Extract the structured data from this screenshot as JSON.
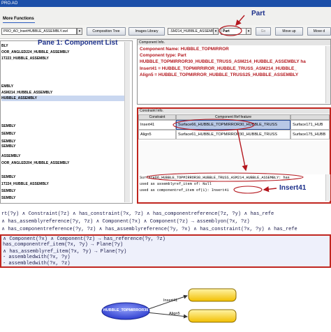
{
  "app": {
    "title": "PRO.AO",
    "menu_more": "More Functions"
  },
  "toolbar": {
    "file_field": "PRO_AO_InsetHUBBLE_ASSEMBLY.swl",
    "composition_tree": "Composition Tree",
    "images_library": "Images Library",
    "assembly_field": ".SM214_HUBBLE_ASSEMBL",
    "type_select": "Part",
    "go": "Go",
    "move_up": "Move up",
    "move_down": "Move d"
  },
  "annotations": {
    "part_callout": "Part",
    "pane1_label": "Pane 1: Component List",
    "insert41_callout": "Insert41"
  },
  "component_list": [
    "BLY",
    "OOR_ANGLED224_HUBBLE_ASSEMBLY",
    "1T223_HUBBLE_ASSEMBLY",
    "EMBLY",
    "ASM214_HUBBLE_ASSEMBLY",
    "HUBBLE_ASSEMBLY",
    "SEMBLY",
    "SEMBLY",
    "SEMBLY",
    "SEMBLY",
    "ASSEMBLY",
    "OOR_ANGLED204_HUBBLE_ASSEMBLY",
    "SEMBLY",
    "1T224_HUBBLE_ASSEMBLY",
    "SEMBLY",
    "SEMBLY"
  ],
  "component_info": {
    "header": "Component Info.",
    "name_line": "Component Name: HUBBLE_TOPMIRROR",
    "type_line": "Component type: Part",
    "line3": "HUBBLE_TOPMIRROR30_HUBBLE_TRUSS_ASM214_HUBBLE_ASSEMBLY ha",
    "line4": "Insert41 = HUBBLE_TOPMIRRIROR_HUBBLE_TRUSS_ASM214_HUBBLE_",
    "line5": "Align5 = HUBBLE_TOPMIRROR_HUBBLE_TRUSS25_HUBBLE_ASSEMBLY"
  },
  "constraint_info": {
    "header": "Constraint Info.",
    "columns": [
      "Constraint",
      "Component Ref feature",
      ""
    ],
    "rows": [
      [
        "Insert41",
        "Surface66_HUBBLE_TOPMIRROR30_HUBBLE_TRUSS",
        "Surface171_HUB"
      ],
      [
        "Align5",
        "Surface61_HUBBLE_TOPMIRROR30_HUBBLE_TRUSS",
        "Surface175_HUBB"
      ]
    ]
  },
  "detail_text": [
    "Surface66_HUBBLE_TOPMIRROR30_HUBBLE_TRUSS_ASM214_HUBBLE_ASSEMBLY: has",
    "used as assemblyref_item of: Null",
    "used as componentref_item of(1): Insert41"
  ],
  "formula": {
    "upper": [
      "rt(?y) ∧ Constraint(?z) ∧ has_constraint(?x, ?z) ∧ has_componentreference(?z, ?y) ∧ has_refe",
      "∧ has_assemblyreference(?y, ?z) ∧ Component(?x) ∧ Component(?z) → assemblyon(?x, ?z)",
      "∧ has_componentreference(?y, ?z) ∧ has_assemblyreference(?y, ?x) ∧ has_constraint(?x, ?y) ∧ has_refe"
    ],
    "lower": [
      "∧ Component(?x) ∧ Component(?z) → has_reference(?y, ?z)",
      "has_componentref_item(?x, ?y) → Plane(?y)",
      "∧ has_assemblyref_item(?x, ?y) → Plane(?y)",
      "- assembledwith(?x, ?y)",
      "- assembledwith(?x, ?z)"
    ]
  },
  "graph": {
    "center_node": "HUBBLE_TOPMIRROR30",
    "edge1": "Insert41",
    "edge2": "Align5",
    "colors": {
      "center": "#3a4bd8",
      "target": "#f5c400",
      "arrow": "#b4171e"
    }
  }
}
